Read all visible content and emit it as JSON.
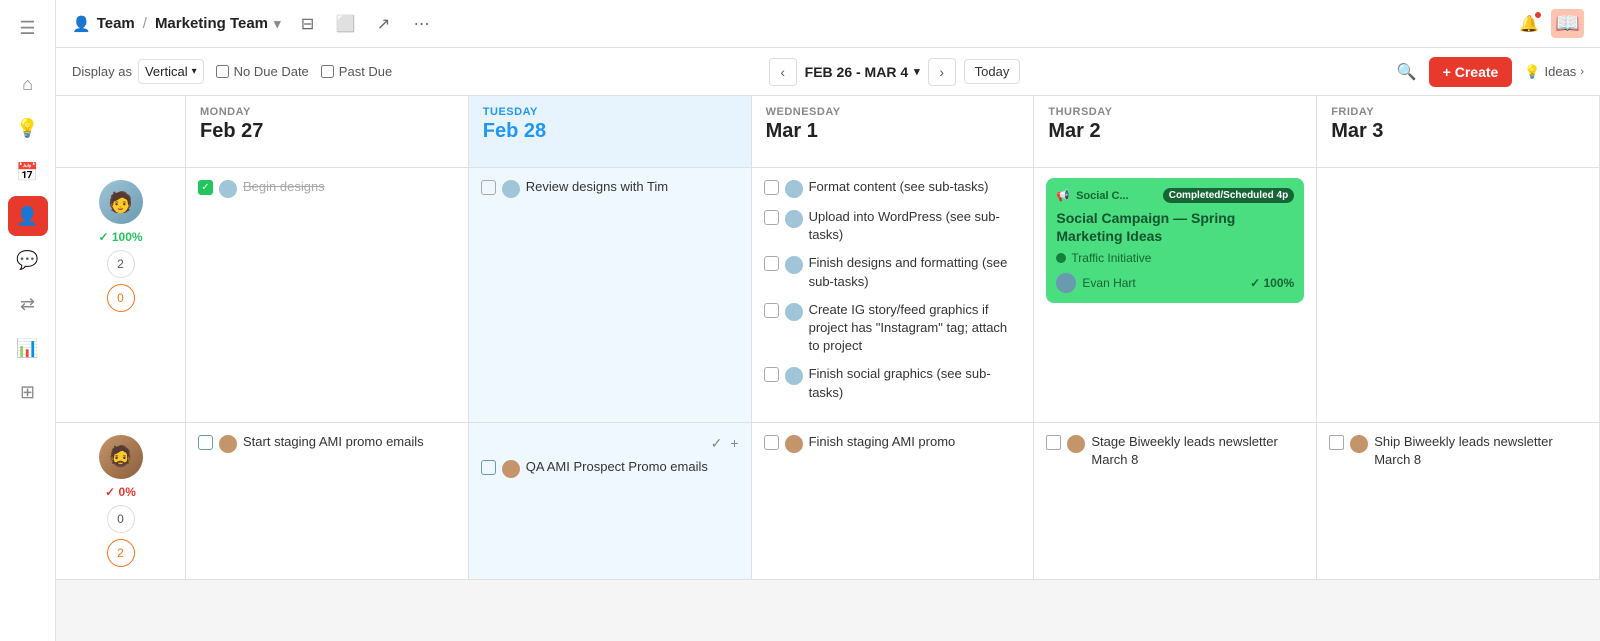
{
  "topbar": {
    "menu_icon": "☰",
    "team_icon": "👤",
    "team_label": "Team",
    "separator": "/",
    "marketing_team": "Marketing Team",
    "chevron": "▾",
    "filter_icon": "⊟",
    "screen_icon": "⬜",
    "share_icon": "↗",
    "more_icon": "⋯"
  },
  "notifications": {
    "icon": "🔔",
    "book_icon": "📖"
  },
  "toolbar": {
    "display_label": "Display as",
    "display_value": "Vertical",
    "no_due_date": "No Due Date",
    "past_due": "Past Due",
    "date_range": "FEB 26 - MAR 4",
    "today_label": "Today",
    "search_icon": "🔍",
    "create_label": "+ Create",
    "ideas_label": "Ideas",
    "ideas_icon": "💡"
  },
  "days": [
    {
      "name": "MONDAY",
      "date": "Feb 27",
      "is_today": false
    },
    {
      "name": "TUESDAY",
      "date": "Feb 28",
      "is_today": true
    },
    {
      "name": "WEDNESDAY",
      "date": "Mar 1",
      "is_today": false
    },
    {
      "name": "THURSDAY",
      "date": "Mar 2",
      "is_today": false
    },
    {
      "name": "FRIDAY",
      "date": "Mar 3",
      "is_today": false
    }
  ],
  "rows": [
    {
      "person": {
        "avatar_type": "person1",
        "progress": "100%",
        "progress_color": "green",
        "bubble1": "2",
        "bubble2": "0",
        "bubble2_color": "orange"
      },
      "tasks": {
        "monday": [
          {
            "checked": true,
            "text": "Begin designs",
            "strikethrough": true
          }
        ],
        "tuesday": [
          {
            "checked": false,
            "text": "Review designs with Tim"
          }
        ],
        "wednesday": [
          {
            "checked": false,
            "text": "Format content (see sub-tasks)"
          },
          {
            "checked": false,
            "text": "Upload into WordPress (see sub-tasks)"
          },
          {
            "checked": false,
            "text": "Finish designs and formatting (see sub-tasks)"
          },
          {
            "checked": false,
            "text": "Create IG story/feed graphics if project has \"Instagram\" tag; attach to project"
          },
          {
            "checked": false,
            "text": "Finish social graphics (see sub-tasks)"
          }
        ],
        "thursday_card": {
          "tag_icon": "📢",
          "tag_short": "Social C...",
          "badge": "Completed/Scheduled 4p",
          "title": "Social Campaign — Spring Marketing Ideas",
          "initiative": "Traffic Initiative",
          "user": "Evan Hart",
          "progress": "100%"
        },
        "friday": []
      }
    },
    {
      "person": {
        "avatar_type": "person2",
        "progress": "0%",
        "progress_color": "red",
        "bubble1": "0",
        "bubble1_color": "normal",
        "bubble2": "2",
        "bubble2_color": "orange"
      },
      "tasks": {
        "monday": [
          {
            "checked": false,
            "text": "Start staging AMI promo emails"
          }
        ],
        "tuesday": [
          {
            "checked": false,
            "text": "QA AMI Prospect Promo emails"
          }
        ],
        "wednesday": [
          {
            "checked": false,
            "text": "Finish staging AMI promo"
          }
        ],
        "thursday": [
          {
            "checked": false,
            "text": "Stage Biweekly leads newsletter March 8"
          }
        ],
        "friday": [
          {
            "checked": false,
            "text": "Ship Biweekly leads newsletter March 8"
          }
        ]
      }
    }
  ]
}
